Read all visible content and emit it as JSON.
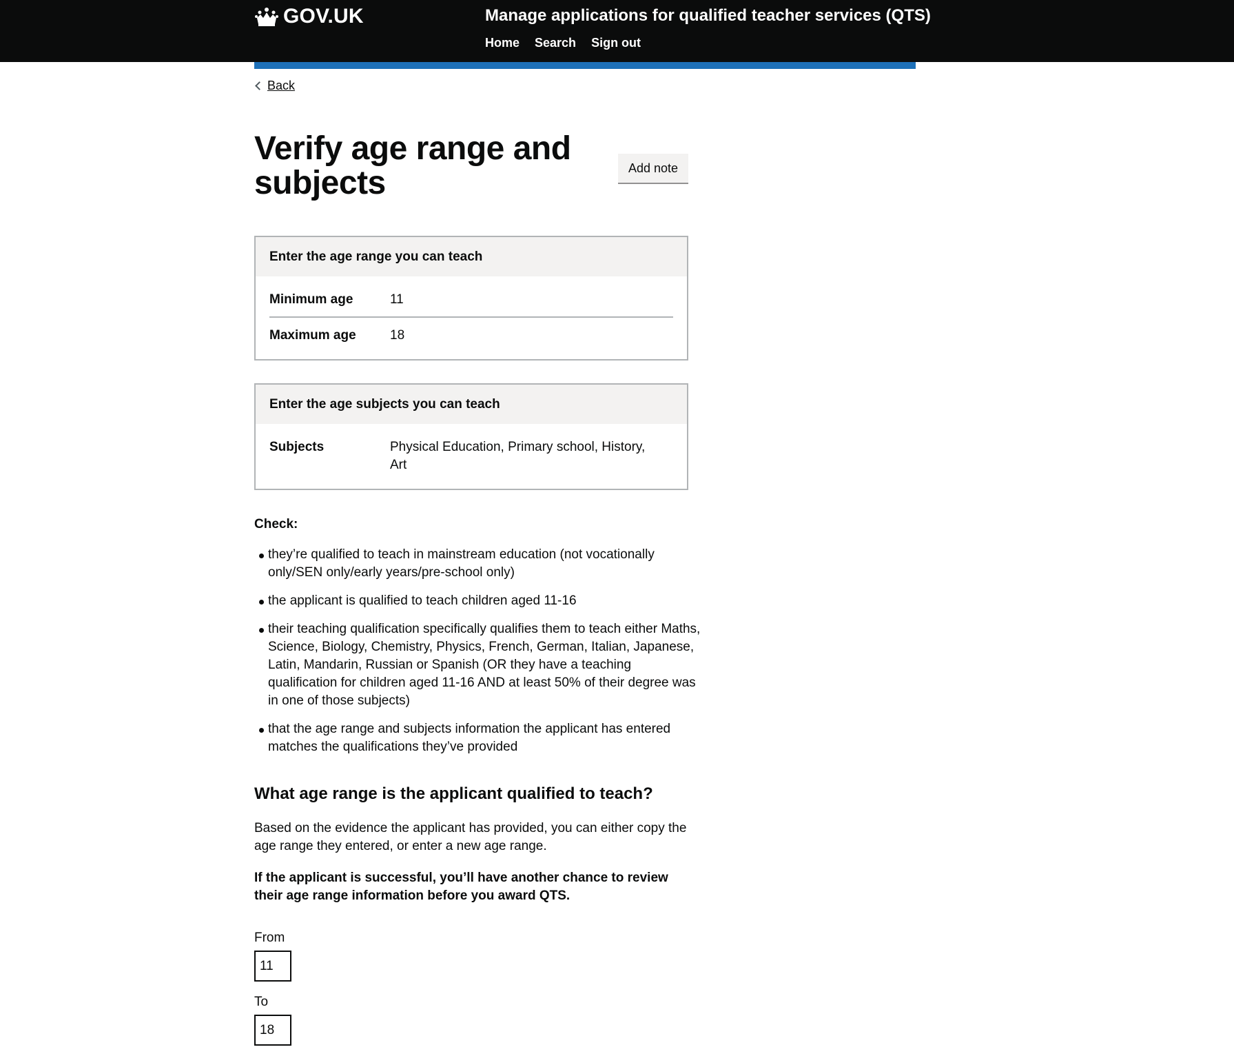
{
  "header": {
    "logo_text": "GOV.UK",
    "service_name": "Manage applications for qualified teacher services (QTS)",
    "nav": [
      "Home",
      "Search",
      "Sign out"
    ]
  },
  "back_link": "Back",
  "page_title": "Verify age range and subjects",
  "add_note_label": "Add note",
  "age_card": {
    "heading": "Enter the age range you can teach",
    "rows": [
      {
        "key": "Minimum age",
        "value": "11"
      },
      {
        "key": "Maximum age",
        "value": "18"
      }
    ]
  },
  "subjects_card": {
    "heading": "Enter the age subjects you can teach",
    "rows": [
      {
        "key": "Subjects",
        "value": "Physical Education, Primary school, History, Art"
      }
    ]
  },
  "check_title": "Check:",
  "check_items": [
    "they’re qualified to teach in mainstream education (not vocationally only/SEN only/early years/pre-school only)",
    "the applicant is qualified to teach children aged 11-16",
    "their teaching qualification specifically qualifies them to teach either Maths, Science, Biology, Chemistry, Physics, French, German, Italian, Japanese, Latin, Mandarin, Russian or Spanish (OR they have a teaching qualification for children aged 11-16 AND at least 50% of their degree was in one of those subjects)",
    "that the age range and subjects information the applicant has entered matches the qualifications they’ve provided"
  ],
  "question_heading": "What age range is the applicant qualified to teach?",
  "question_hint": "Based on the evidence the applicant has provided, you can either copy the age range they entered, or enter a new age range.",
  "question_note": "If the applicant is successful, you’ll have another chance to review their age range information before you award QTS.",
  "from_label": "From",
  "from_value": "11",
  "to_label": "To",
  "to_value": "18"
}
